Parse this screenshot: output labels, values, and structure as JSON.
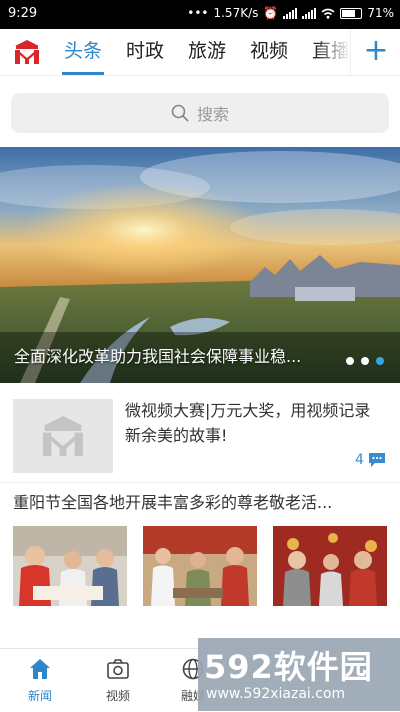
{
  "status_bar": {
    "time": "9:29",
    "network_speed": "1.57K/s",
    "battery": "71%"
  },
  "channels": {
    "tabs": [
      {
        "label": "头条",
        "active": true
      },
      {
        "label": "时政",
        "active": false
      },
      {
        "label": "旅游",
        "active": false
      },
      {
        "label": "视频",
        "active": false
      },
      {
        "label": "直播",
        "active": false
      }
    ],
    "add_label": "+"
  },
  "search": {
    "placeholder": "搜索"
  },
  "banner": {
    "caption": "全面深化改革助力我国社会保障事业稳...",
    "slides_total": 3,
    "active_slide": 3
  },
  "articles": [
    {
      "title": "微视频大赛|万元大奖，用视频记录新余美的故事!",
      "comment_count": "4"
    },
    {
      "title": "重阳节全国各地开展丰富多彩的尊老敬老活..."
    }
  ],
  "bottom_nav": [
    {
      "label": "新闻",
      "icon": "home-icon",
      "active": true
    },
    {
      "label": "视频",
      "icon": "camera-icon",
      "active": false
    },
    {
      "label": "融媒",
      "icon": "globe-icon",
      "active": false
    }
  ],
  "watermark": {
    "brand": "592软件园",
    "url": "www.592xiazai.com"
  },
  "colors": {
    "accent": "#2f86c8",
    "status_bar_bg": "#000000",
    "search_bg": "#efefef",
    "indicator_active": "#3aa3e3"
  }
}
